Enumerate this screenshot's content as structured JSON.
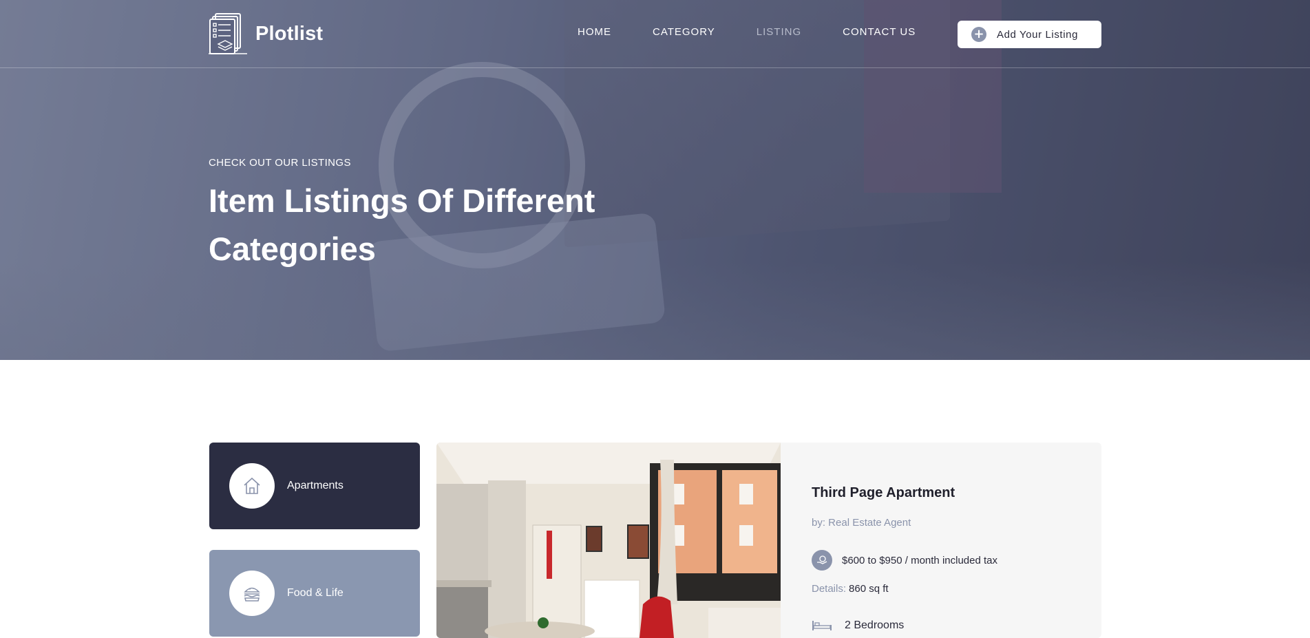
{
  "header": {
    "brand": "Plotlist",
    "nav": [
      {
        "label": "HOME",
        "active": false
      },
      {
        "label": "CATEGORY",
        "active": false
      },
      {
        "label": "LISTING",
        "active": true
      },
      {
        "label": "CONTACT US",
        "active": false
      }
    ],
    "add_button": {
      "icon": "plus-circle-icon",
      "label": "Add Your Listing"
    }
  },
  "hero": {
    "kicker": "CHECK OUT OUR LISTINGS",
    "title": "Item Listings Of Different Categories"
  },
  "categories": [
    {
      "label": "Apartments",
      "icon": "house-icon",
      "active": true
    },
    {
      "label": "Food & Life",
      "icon": "burger-icon",
      "active": false
    }
  ],
  "listing": {
    "title": "Third Page Apartment",
    "by": "by: Real Estate Agent",
    "price": "$600 to $950 / month included tax",
    "price_icon": "money-hand-icon",
    "details_key": "Details:",
    "details_value": "860 sq ft",
    "bedrooms": "2 Bedrooms",
    "bed_icon": "bed-icon"
  },
  "colors": {
    "accent": "#8a93ab",
    "dark_card": "#2b2d42",
    "light_card": "#8a97b0",
    "listing_bg": "#f6f6f6"
  }
}
